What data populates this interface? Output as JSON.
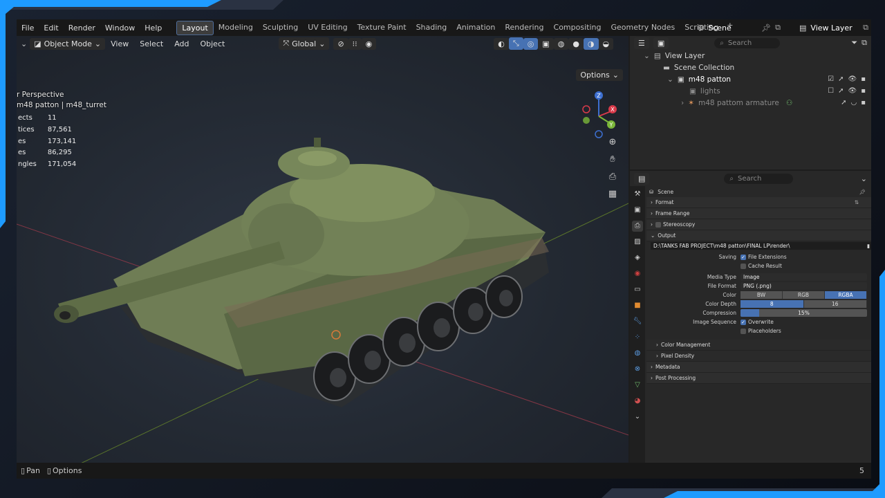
{
  "menu": {
    "items": [
      "File",
      "Edit",
      "Render",
      "Window",
      "Help"
    ]
  },
  "workspace_tabs": [
    "Layout",
    "Modeling",
    "Sculpting",
    "UV Editing",
    "Texture Paint",
    "Shading",
    "Animation",
    "Rendering",
    "Compositing",
    "Geometry Nodes",
    "Scripting"
  ],
  "active_tab": "Layout",
  "scene": {
    "label": "Scene"
  },
  "view_layer": {
    "label": "View Layer"
  },
  "viewport": {
    "mode": "Object Mode",
    "menus": [
      "View",
      "Select",
      "Add",
      "Object"
    ],
    "transform": "Global",
    "options": "Options",
    "perspective": "r Perspective",
    "object_path": "m48 patton | m48_turret",
    "stats": [
      {
        "label": "ects",
        "value": "11"
      },
      {
        "label": "tices",
        "value": "87,561"
      },
      {
        "label": "es",
        "value": "173,141"
      },
      {
        "label": "es",
        "value": "86,295"
      },
      {
        "label": "ngles",
        "value": "171,054"
      }
    ],
    "gizmo": {
      "x": "X",
      "y": "Y",
      "z": "Z"
    }
  },
  "outliner": {
    "search_placeholder": "Search",
    "rows": [
      {
        "label": "View Layer"
      },
      {
        "label": "Scene Collection"
      },
      {
        "label": "m48 patton"
      },
      {
        "label": "lights"
      },
      {
        "label": "m48 pattom armature"
      }
    ]
  },
  "properties": {
    "search_placeholder": "Search",
    "context": "Scene",
    "panels": {
      "format": "Format",
      "frame_range": "Frame Range",
      "stereoscopy": "Stereoscopy",
      "output": "Output",
      "color_management": "Color Management",
      "pixel_density": "Pixel Density",
      "metadata": "Metadata",
      "post_processing": "Post Processing"
    },
    "output_path": "D:\\TANKS FAB PROJECT\\m48 patton\\FINAL LP\\render\\",
    "saving_label": "Saving",
    "file_extensions": "File Extensions",
    "cache_result": "Cache Result",
    "media_type_label": "Media Type",
    "media_type": "Image",
    "file_format_label": "File Format",
    "file_format": "PNG (.png)",
    "color_label": "Color",
    "color_options": [
      "BW",
      "RGB",
      "RGBA"
    ],
    "color_selected": "RGBA",
    "color_depth_label": "Color Depth",
    "color_depth_options": [
      "8",
      "16"
    ],
    "color_depth_selected": "8",
    "compression_label": "Compression",
    "compression": "15%",
    "compression_fraction": 0.15,
    "image_sequence_label": "Image Sequence",
    "overwrite": "Overwrite",
    "placeholders": "Placeholders"
  },
  "statusbar": {
    "pan": "Pan",
    "options": "Options",
    "right": "5"
  },
  "colors": {
    "accent": "#4772b3",
    "frame_blue": "#1e9bff"
  }
}
